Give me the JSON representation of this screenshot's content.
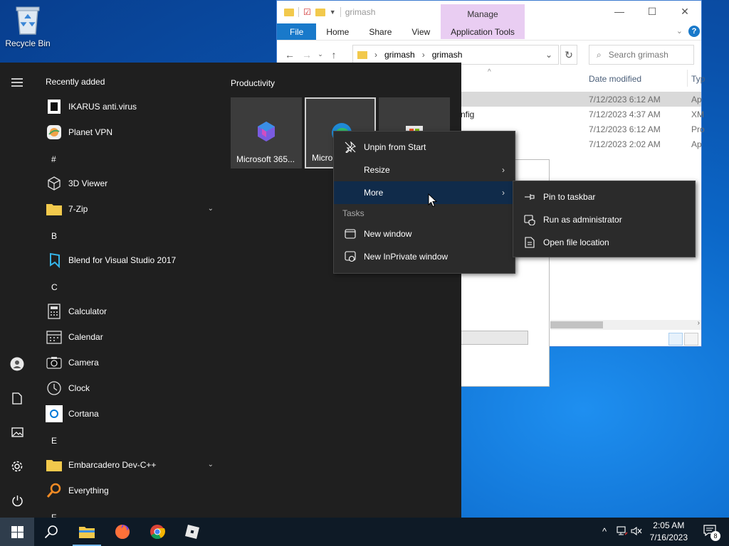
{
  "desktop": {
    "recycle_bin": "Recycle Bin"
  },
  "explorer": {
    "title": "grimash",
    "manage_tab": "Manage",
    "app_tools_tab": "Application Tools",
    "ribbon_tabs": [
      "File",
      "Home",
      "Share",
      "View"
    ],
    "breadcrumb": [
      "grimash",
      "grimash"
    ],
    "search_placeholder": "Search grimash",
    "col_date": "Date modified",
    "col_type": "Typ",
    "rows": [
      {
        "name": "",
        "date": "7/12/2023 6:12 AM",
        "type": "Ap"
      },
      {
        "name": "nfig",
        "date": "7/12/2023 4:37 AM",
        "type": "XM"
      },
      {
        "name": "",
        "date": "7/12/2023 6:12 AM",
        "type": "Pro"
      },
      {
        "name": "",
        "date": "7/12/2023 2:02 AM",
        "type": "Ap"
      }
    ]
  },
  "start_menu": {
    "recently_added": "Recently added",
    "apps": {
      "ikarus": "IKARUS anti.virus",
      "planet_vpn": "Planet VPN",
      "hash": "#",
      "viewer3d": "3D Viewer",
      "zip7": "7-Zip",
      "letter_b": "B",
      "blend": "Blend for Visual Studio 2017",
      "letter_c": "C",
      "calculator": "Calculator",
      "calendar": "Calendar",
      "camera": "Camera",
      "clock": "Clock",
      "cortana": "Cortana",
      "letter_e": "E",
      "embarcadero": "Embarcadero Dev-C++",
      "everything": "Everything",
      "letter_f": "F"
    },
    "group_title": "Productivity",
    "tiles": [
      "Microsoft 365...",
      "Micro"
    ]
  },
  "context_menu": {
    "unpin": "Unpin from Start",
    "resize": "Resize",
    "more": "More",
    "tasks": "Tasks",
    "new_window": "New window",
    "new_inprivate": "New InPrivate window"
  },
  "submenu": {
    "pin_taskbar": "Pin to taskbar",
    "run_admin": "Run as administrator",
    "open_location": "Open file location"
  },
  "taskbar": {
    "time": "2:05 AM",
    "date": "7/16/2023",
    "notification_count": "8"
  },
  "colors": {
    "accent": "#1979ca",
    "menu_bg": "#2b2b2b",
    "start_bg": "#1f1f1f",
    "highlight": "#102b4a"
  }
}
